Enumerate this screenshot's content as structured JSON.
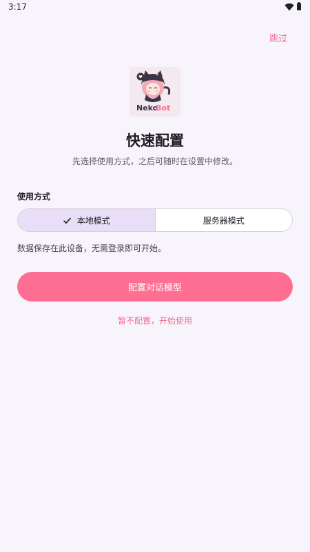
{
  "status_bar": {
    "time": "3:17",
    "icons": [
      "wifi-icon",
      "battery-icon"
    ]
  },
  "header": {
    "skip_label": "跳过"
  },
  "logo": {
    "brand_first": "Neko",
    "brand_second": "Bot",
    "colors": {
      "first": "#3c3346",
      "second": "#ff6f93"
    }
  },
  "main": {
    "title": "快速配置",
    "subtitle": "先选择使用方式，之后可随时在设置中修改。",
    "usage_label": "使用方式",
    "modes": [
      {
        "label": "本地模式",
        "selected": true
      },
      {
        "label": "服务器模式",
        "selected": false
      }
    ],
    "mode_description": "数据保存在此设备，无需登录即可开始。",
    "primary_button": "配置对话模型",
    "secondary_link": "暂不配置，开始使用"
  },
  "colors": {
    "accent": "#ff6f93",
    "link": "#ec6d91",
    "background": "#f7f5fb",
    "segment_selected": "#e8def8"
  }
}
